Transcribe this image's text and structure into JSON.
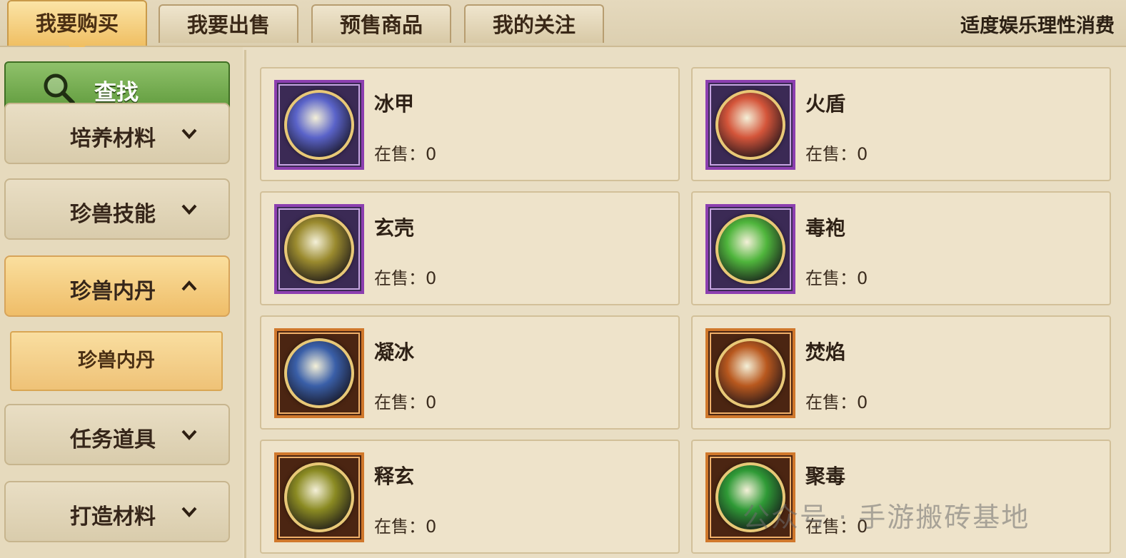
{
  "tabs": [
    {
      "label": "我要购买",
      "active": true
    },
    {
      "label": "我要出售",
      "active": false
    },
    {
      "label": "预售商品",
      "active": false
    },
    {
      "label": "我的关注",
      "active": false
    }
  ],
  "notice": "适度娱乐理性消费",
  "sidebar": {
    "search_label": "查找",
    "categories": [
      {
        "label": "培养材料",
        "state": "collapsed"
      },
      {
        "label": "珍兽技能",
        "state": "collapsed"
      },
      {
        "label": "珍兽内丹",
        "state": "expanded"
      },
      {
        "label": "任务道具",
        "state": "collapsed"
      },
      {
        "label": "打造材料",
        "state": "collapsed"
      }
    ],
    "subcategory": "珍兽内丹"
  },
  "items": [
    {
      "name": "冰甲",
      "stock_label": "在售：",
      "stock": "0",
      "frame": "purple",
      "orb": "#5a63c9"
    },
    {
      "name": "火盾",
      "stock_label": "在售：",
      "stock": "0",
      "frame": "purple",
      "orb": "#d4553a"
    },
    {
      "name": "玄壳",
      "stock_label": "在售：",
      "stock": "0",
      "frame": "purple",
      "orb": "#9a8a2e"
    },
    {
      "name": "毒袍",
      "stock_label": "在售：",
      "stock": "0",
      "frame": "purple",
      "orb": "#4fb53c"
    },
    {
      "name": "凝冰",
      "stock_label": "在售：",
      "stock": "0",
      "frame": "orange",
      "orb": "#3a5fa8"
    },
    {
      "name": "焚焰",
      "stock_label": "在售：",
      "stock": "0",
      "frame": "orange",
      "orb": "#b8581e"
    },
    {
      "name": "释玄",
      "stock_label": "在售：",
      "stock": "0",
      "frame": "orange",
      "orb": "#8a8a22"
    },
    {
      "name": "聚毒",
      "stock_label": "在售：",
      "stock": "0",
      "frame": "orange",
      "orb": "#2f9a36"
    }
  ],
  "watermark": "公众号 · 手游搬砖基地"
}
